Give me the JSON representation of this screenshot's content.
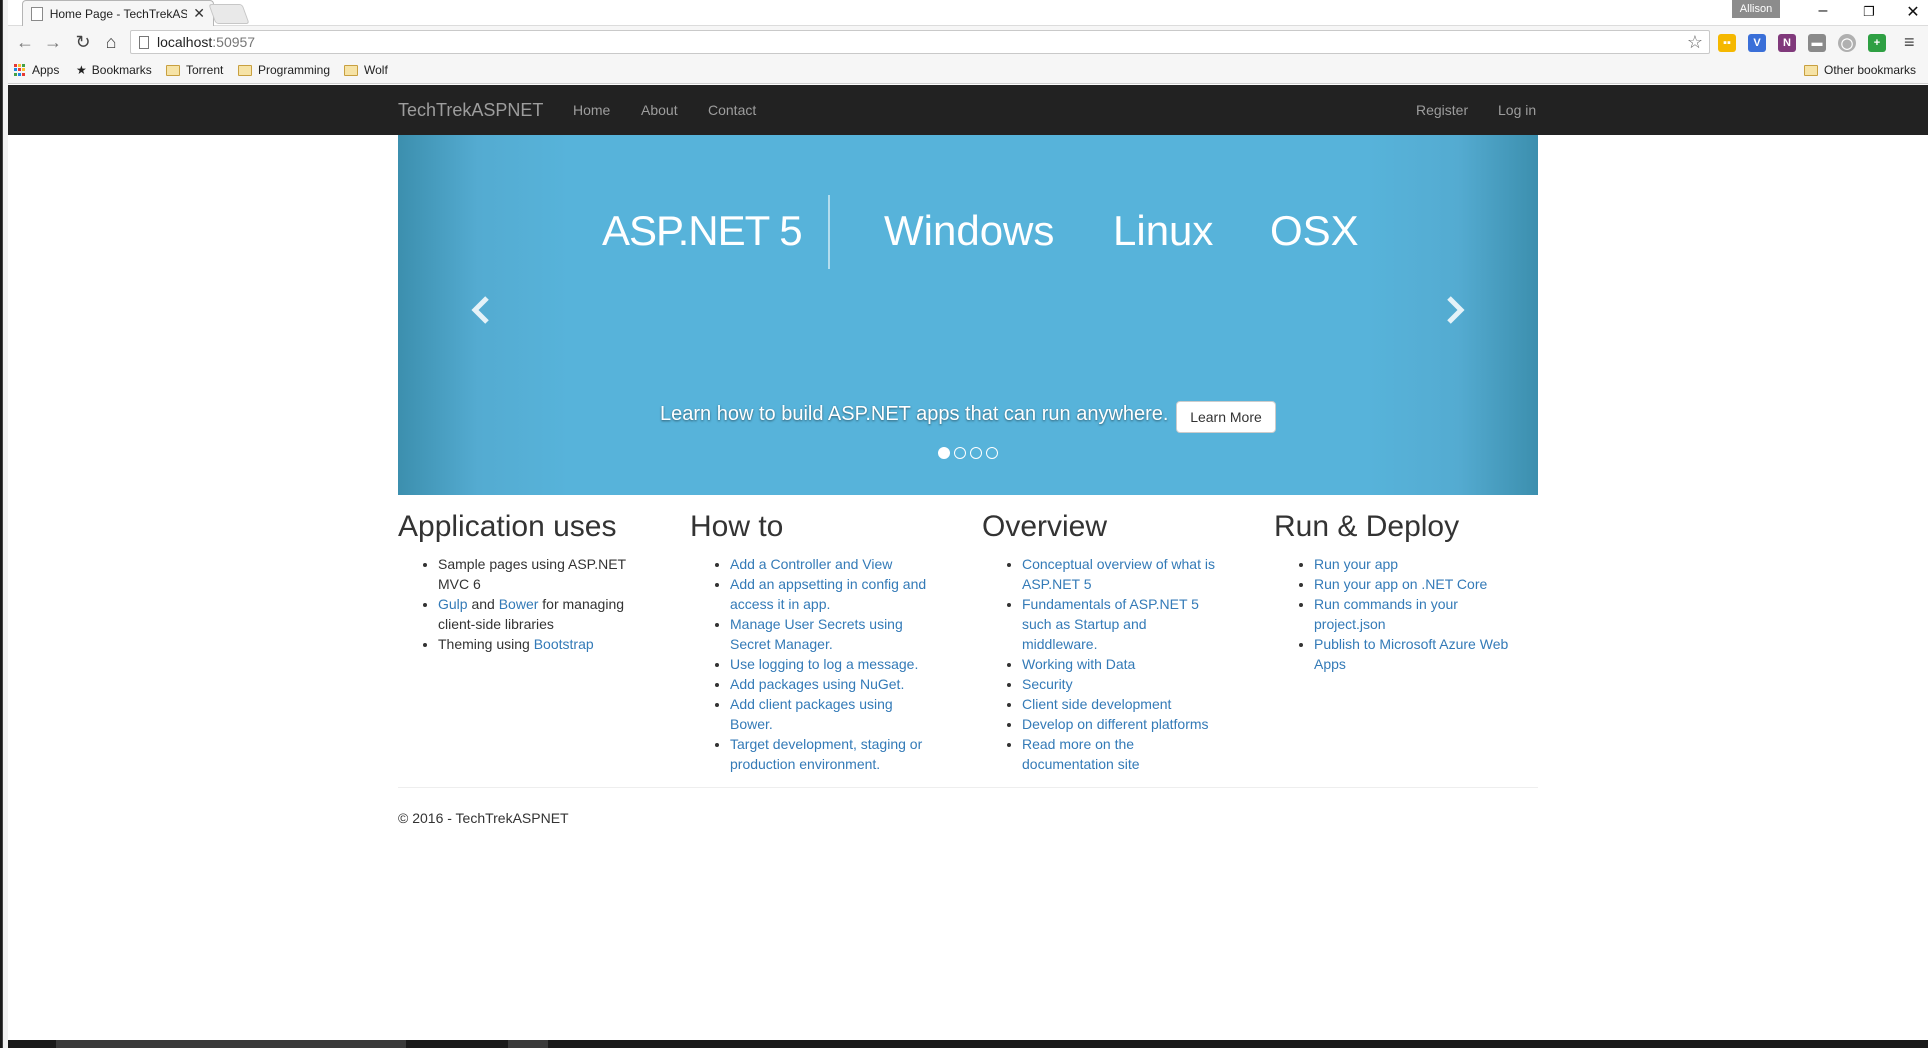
{
  "browser": {
    "tab_title": "Home Page - TechTrekASP",
    "tab_close": "✕",
    "user_badge": "Allison",
    "window_minimize": "–",
    "window_restore": "❐",
    "window_close": "✕",
    "url_host": "localhost",
    "url_port": ":50957",
    "back_icon": "←",
    "forward_icon": "→",
    "reload_icon": "↻",
    "home_icon": "⌂",
    "star_icon": "☆",
    "menu_icon": "≡",
    "extensions": [
      {
        "name": "ext-yellow",
        "label": "▪▪",
        "color": "#f5b800"
      },
      {
        "name": "ext-blue",
        "label": "V",
        "color": "#3a6fd8"
      },
      {
        "name": "ext-onenote",
        "label": "N",
        "color": "#80397b"
      },
      {
        "name": "ext-gray",
        "label": "▬",
        "color": "#8a8a8a"
      },
      {
        "name": "ext-circle",
        "label": "◯",
        "color": "#b0b0b0"
      },
      {
        "name": "ext-green",
        "label": "+",
        "color": "#2ea043"
      }
    ],
    "bookmarks": {
      "apps": "Apps",
      "bookmarks": "Bookmarks",
      "torrent": "Torrent",
      "programming": "Programming",
      "wolf": "Wolf",
      "other": "Other bookmarks"
    }
  },
  "site": {
    "brand": "TechTrekASPNET",
    "nav": {
      "home": "Home",
      "about": "About",
      "contact": "Contact",
      "register": "Register",
      "login": "Log in"
    },
    "carousel": {
      "main": "ASP.NET 5",
      "platforms": [
        "Windows",
        "Linux",
        "OSX"
      ],
      "caption": "Learn how to build ASP.NET apps that can run anywhere.",
      "button": "Learn More",
      "prev_icon": "‹",
      "next_icon": "›",
      "slide_count": 4,
      "active_slide": 1
    },
    "columns": {
      "app_uses": {
        "title": "Application uses",
        "item1": "Sample pages using ASP.NET MVC 6",
        "item2_link1": "Gulp",
        "item2_and": " and ",
        "item2_link2": "Bower",
        "item2_rest": " for managing client-side libraries",
        "item3_text": "Theming using ",
        "item3_link": "Bootstrap"
      },
      "how_to": {
        "title": "How to",
        "items": [
          "Add a Controller and View",
          "Add an appsetting in config and access it in app.",
          "Manage User Secrets using Secret Manager.",
          "Use logging to log a message.",
          "Add packages using NuGet.",
          "Add client packages using Bower.",
          "Target development, staging or production environment."
        ]
      },
      "overview": {
        "title": "Overview",
        "items": [
          "Conceptual overview of what is ASP.NET 5",
          "Fundamentals of ASP.NET 5 such as Startup and middleware.",
          "Working with Data",
          "Security",
          "Client side development",
          "Develop on different platforms",
          "Read more on the documentation site"
        ]
      },
      "run_deploy": {
        "title": "Run & Deploy",
        "items": [
          "Run your app",
          "Run your app on .NET Core",
          "Run commands in your project.json",
          "Publish to Microsoft Azure Web Apps"
        ]
      }
    },
    "footer": "© 2016 - TechTrekASPNET"
  }
}
